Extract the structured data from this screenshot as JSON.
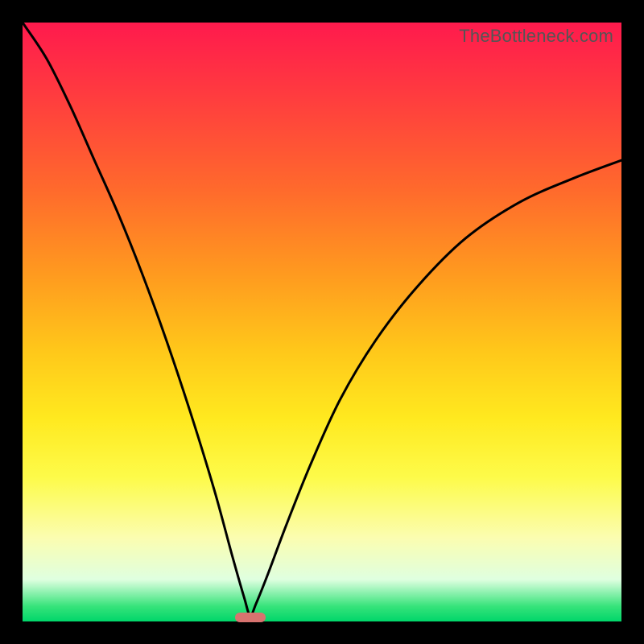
{
  "watermark": "TheBottleneck.com",
  "colors": {
    "curve": "#000000",
    "marker": "#d8736f",
    "frame": "#000000"
  },
  "chart_data": {
    "type": "line",
    "title": "",
    "xlabel": "",
    "ylabel": "",
    "xlim": [
      0,
      100
    ],
    "ylim": [
      0,
      100
    ],
    "grid": false,
    "legend": false,
    "note": "V-shaped bottleneck curve. Minimum (green zone) near x≈38. Values are read off the plot as percentage of vertical extent (top=100, bottom=0).",
    "series": [
      {
        "name": "bottleneck-curve",
        "x": [
          0,
          4,
          8,
          12,
          16,
          20,
          24,
          28,
          32,
          35,
          37,
          38,
          39,
          41,
          44,
          48,
          53,
          59,
          66,
          74,
          83,
          92,
          100
        ],
        "y": [
          100,
          94,
          86,
          77,
          68,
          58,
          47,
          35,
          22,
          11,
          4,
          1,
          3,
          8,
          16,
          26,
          37,
          47,
          56,
          64,
          70,
          74,
          77
        ]
      }
    ],
    "marker": {
      "x": 38,
      "y": 0
    }
  }
}
